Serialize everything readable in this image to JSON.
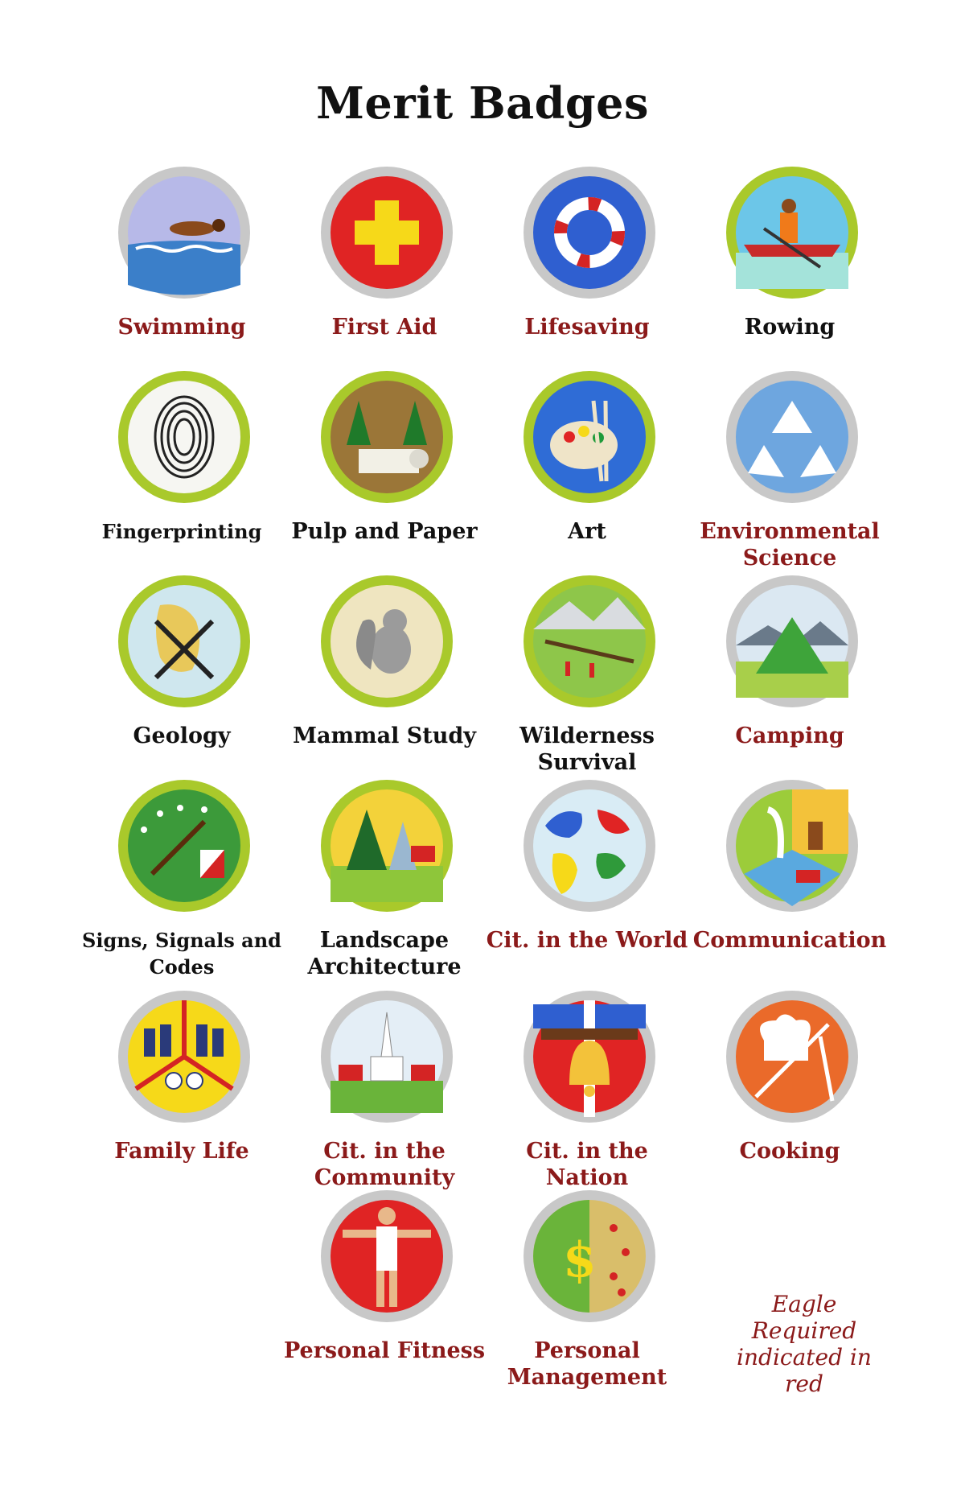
{
  "title": "Merit Badges",
  "colors": {
    "required": "#8b1a1a",
    "normal": "#111111",
    "border_silver": "#c8c8c8",
    "border_green": "#a9c92b"
  },
  "badges": [
    {
      "label": "Swimming",
      "required": true,
      "icon": "swimmer-icon",
      "border": "silver"
    },
    {
      "label": "First Aid",
      "required": true,
      "icon": "red-cross-icon",
      "border": "silver"
    },
    {
      "label": "Lifesaving",
      "required": true,
      "icon": "life-ring-icon",
      "border": "silver"
    },
    {
      "label": "Rowing",
      "required": false,
      "icon": "rower-icon",
      "border": "green"
    },
    {
      "label": "Fingerprinting",
      "required": false,
      "icon": "fingerprint-icon",
      "border": "green"
    },
    {
      "label": "Pulp and Paper",
      "required": false,
      "icon": "trees-paper-roll-icon",
      "border": "green"
    },
    {
      "label": "Art",
      "required": false,
      "icon": "palette-brushes-icon",
      "border": "green"
    },
    {
      "label": "Environmental Science",
      "required": true,
      "icon": "recycle-icon",
      "border": "silver"
    },
    {
      "label": "Geology",
      "required": false,
      "icon": "rock-hammers-icon",
      "border": "green"
    },
    {
      "label": "Mammal Study",
      "required": false,
      "icon": "squirrel-icon",
      "border": "green"
    },
    {
      "label": "Wilderness Survival",
      "required": false,
      "icon": "shelter-landscape-icon",
      "border": "green"
    },
    {
      "label": "Camping",
      "required": true,
      "icon": "tent-icon",
      "border": "silver"
    },
    {
      "label": "Signs, Signals and Codes",
      "required": false,
      "icon": "semaphore-flag-icon",
      "border": "green"
    },
    {
      "label": "Landscape Architecture",
      "required": false,
      "icon": "landscape-trees-icon",
      "border": "green"
    },
    {
      "label": "Cit. in the World",
      "required": true,
      "icon": "globe-icon",
      "border": "silver"
    },
    {
      "label": "Communication",
      "required": true,
      "icon": "quill-phone-icon",
      "border": "silver"
    },
    {
      "label": "Family Life",
      "required": true,
      "icon": "family-icon",
      "border": "silver"
    },
    {
      "label": "Cit. in the Community",
      "required": true,
      "icon": "town-hall-icon",
      "border": "silver"
    },
    {
      "label": "Cit. in the Nation",
      "required": true,
      "icon": "liberty-bell-icon",
      "border": "silver"
    },
    {
      "label": "Cooking",
      "required": true,
      "icon": "chef-hat-utensils-icon",
      "border": "silver"
    },
    {
      "label": "Personal Fitness",
      "required": true,
      "icon": "athlete-icon",
      "border": "silver"
    },
    {
      "label": "Personal Management",
      "required": true,
      "icon": "dollar-sign-icon",
      "border": "silver"
    }
  ],
  "note": "Eagle Required indicated in red"
}
